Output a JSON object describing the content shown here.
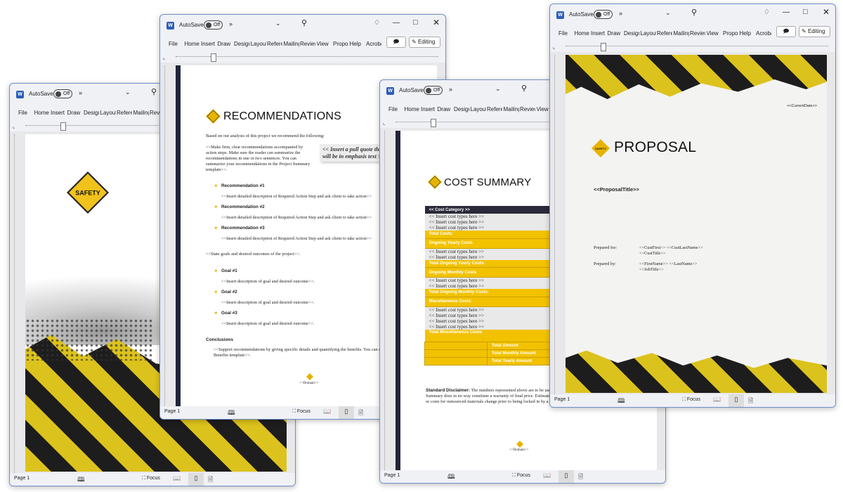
{
  "chrome": {
    "app_icon": "word-icon",
    "autosave_label": "AutoSave",
    "autosave_state": "Off",
    "more_label": "»",
    "tabs": [
      "File",
      "Home",
      "Insert",
      "Draw",
      "Design",
      "Layout",
      "References",
      "Mailings",
      "Review",
      "View",
      "Proposal",
      "Help",
      "Acrobat"
    ],
    "editing_label": "Editing",
    "status_page": "Page 1",
    "focus_label": "Focus"
  },
  "logo_text": "SAFETY",
  "cover": {},
  "recommendations": {
    "title": "RECOMMENDATIONS",
    "intro": "Based on our analysis of this project we recommend the following:",
    "guidance": "<<Make firm, clear recommendations accompanied by action steps.  Make sure the reader can summarize the recommendations in one or two sentences.  You can summarize your recommendations in the Project Summary template>>.",
    "pull_quote": "<< Insert a pull quote that will be in emphasis text >>",
    "items": [
      {
        "label": "Recommendation #1",
        "desc": "<<Insert detailed description of Required Action Step and ask client to take action>>"
      },
      {
        "label": "Recommendation #2",
        "desc": "<<Insert detailed description of Required Action Step and ask client to take action>>"
      },
      {
        "label": "Recommendation #3",
        "desc": "<<Insert detailed description of Required Action Step and ask client to take action>>"
      }
    ],
    "goals_intro": "<<State goals and desired outcomes of the project>>.",
    "goals": [
      {
        "label": "Goal #1",
        "desc": "<<Insert description of goal and desired outcome>>."
      },
      {
        "label": "Goal #2",
        "desc": "<<Insert description of goal and desired outcome>>."
      },
      {
        "label": "Goal #3",
        "desc": "<<Insert description of goal and desired outcome>>."
      }
    ],
    "conclusions_heading": "Conclusions",
    "conclusions_text": "<<Support recommendations by giving specific details and quantifying the benefits.  You can expand on the benefits by adding the Benefits template>>.",
    "footer": "<<Domain>>"
  },
  "cost_summary": {
    "title": "COST SUMMARY",
    "header": "<< Cost Category >>",
    "placeholder": "<< Insert cost types here >>",
    "total_costs": "Total Costs:",
    "ongoing_yearly": "Ongoing Yearly Costs",
    "total_ongoing_yearly": "Total Ongoing Yearly Costs:",
    "ongoing_monthly": "Ongoing Monthly Costs",
    "total_ongoing_monthly": "Total Ongoing Monthly Costs:",
    "misc": "Miscellaneous Costs:",
    "total_misc": "Total Miscellaneous Costs:",
    "total_amount": "Total Amount",
    "total_monthly": "Total Monthly Amount",
    "total_yearly": "Total Yearly Amount",
    "disclaimer_label": "Standard Disclaimer:",
    "disclaimer_text": " The numbers represented above are to be used as an estimate for the projects discussed. The above Cost Summary does in no way constitute a warranty of final price. Estimates are subject to change if project specifications are changed or costs for outsourced materials change prior to being locked in by a binding contract.",
    "footer": "<<Domain>>"
  },
  "proposal": {
    "date": "<<CurrentDate>>",
    "title": "PROPOSAL",
    "proposal_title": "<<ProposalTitle>>",
    "prepared_for_label": "Prepared for:",
    "prepared_for_line1": "<<CustFirst>> <<CustLastName>>",
    "prepared_for_line2": "<<CustTitle>>",
    "prepared_by_label": "Prepared by:",
    "prepared_by_line1": "<<FirstName>> <<LastName>>",
    "prepared_by_line2": "<<JobTitle>>"
  },
  "colors": {
    "safety_yellow": "#f2c200",
    "stripe_black": "#1d1d1d",
    "accent_dark": "#23233a",
    "word_blue": "#2b5eb8"
  }
}
